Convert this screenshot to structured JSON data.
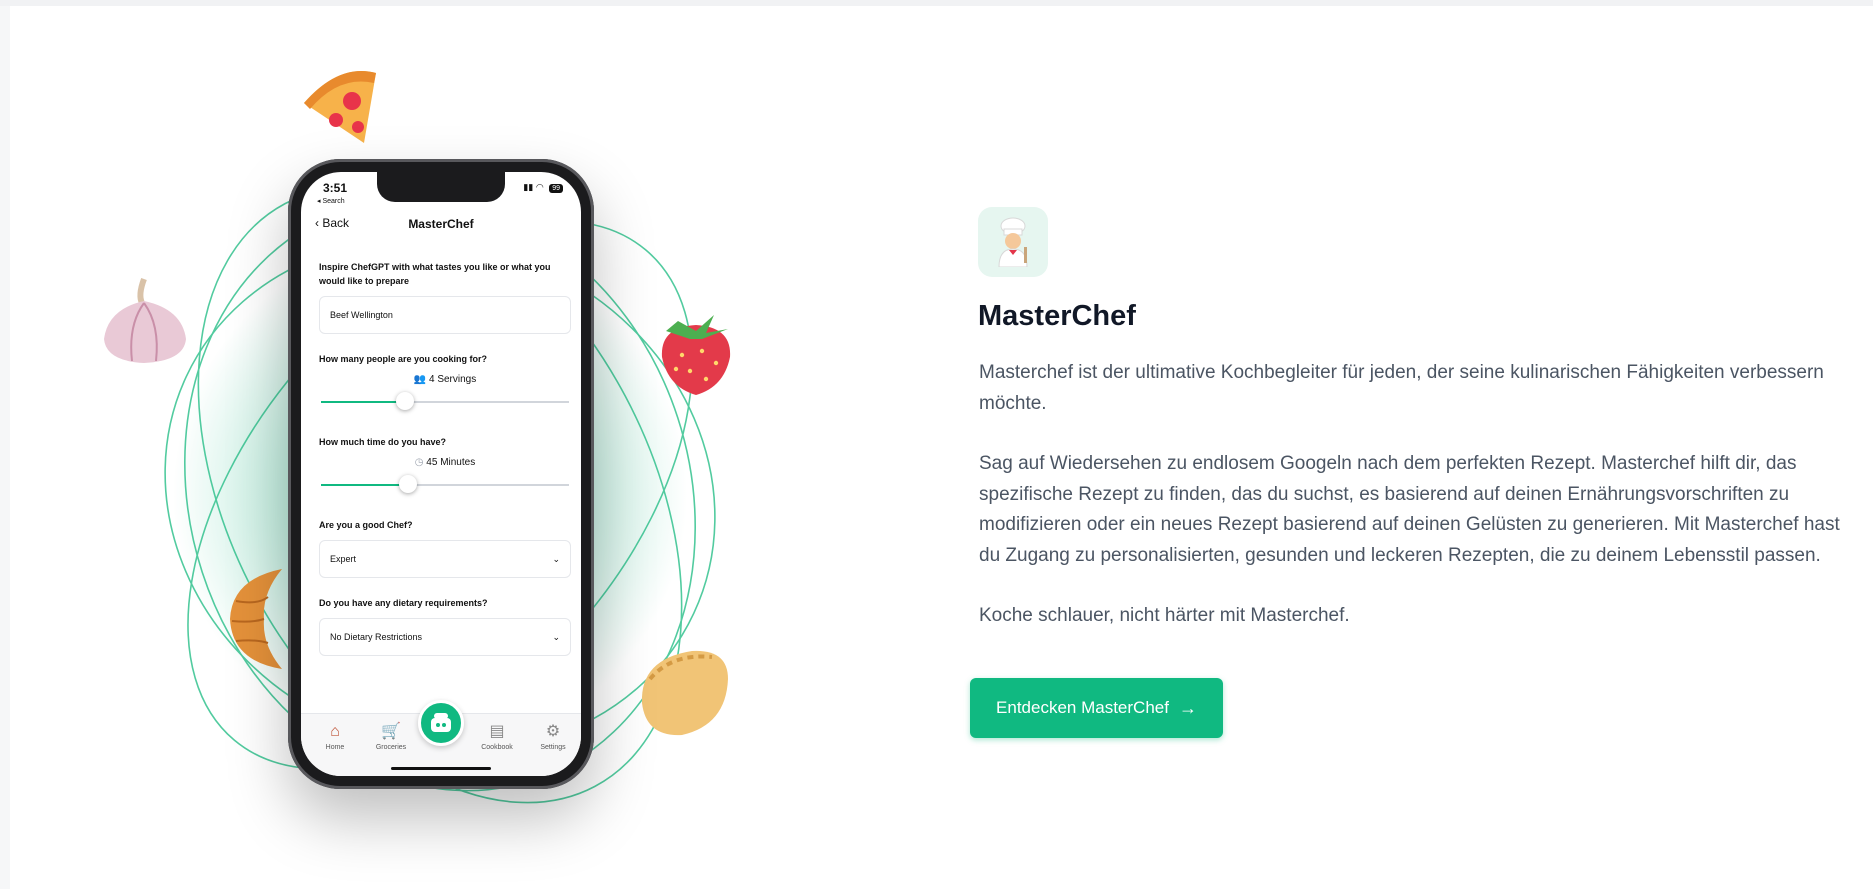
{
  "app": {
    "status_time": "3:51",
    "status_back_hint": "◂ Search",
    "battery": "99",
    "nav_back": "Back",
    "nav_title": "MasterChef",
    "form": {
      "taste_label": "Inspire ChefGPT with what tastes you like or what you would like to prepare",
      "taste_value": "Beef Wellington",
      "people_label": "How many people are you cooking for?",
      "people_value": "4 Servings",
      "people_fraction": 0.34,
      "time_label": "How much time do you have?",
      "time_value": "45 Minutes",
      "time_fraction": 0.35,
      "chef_label": "Are you a good Chef?",
      "chef_value": "Expert",
      "diet_label": "Do you have any dietary requirements?",
      "diet_value": "No Dietary Restrictions"
    },
    "tabs": [
      {
        "label": "Home",
        "icon": "home-icon"
      },
      {
        "label": "Groceries",
        "icon": "cart-icon"
      },
      {
        "label": "",
        "icon": "chef-robot-icon"
      },
      {
        "label": "Cookbook",
        "icon": "book-icon"
      },
      {
        "label": "Settings",
        "icon": "gear-icon"
      }
    ]
  },
  "content": {
    "icon": "chef-icon",
    "title": "MasterChef",
    "paragraphs": [
      "Masterchef ist der ultimative Kochbegleiter für jeden, der seine kulinarischen Fähigkeiten verbessern möchte.",
      "Sag auf Wiedersehen zu endlosem Googeln nach dem perfekten Rezept. Masterchef hilft dir, das spezifische Rezept zu finden, das du suchst, es basierend auf deinen Ernährungsvorschriften zu modifizieren oder ein neues Rezept basierend auf deinen Gelüsten zu generieren. Mit Masterchef hast du Zugang zu personalisierten, gesunden und leckeren Rezepten, die zu deinem Lebensstil passen.",
      "Koche schlauer, nicht härter mit Masterchef."
    ],
    "cta_label": "Entdecken MasterChef",
    "cta_arrow": "→"
  },
  "decorations": [
    "pizza-icon",
    "garlic-icon",
    "strawberry-icon",
    "croissant-icon",
    "dumpling-icon"
  ],
  "colors": {
    "accent": "#10b981",
    "title": "#111827",
    "body": "#4b5563"
  }
}
